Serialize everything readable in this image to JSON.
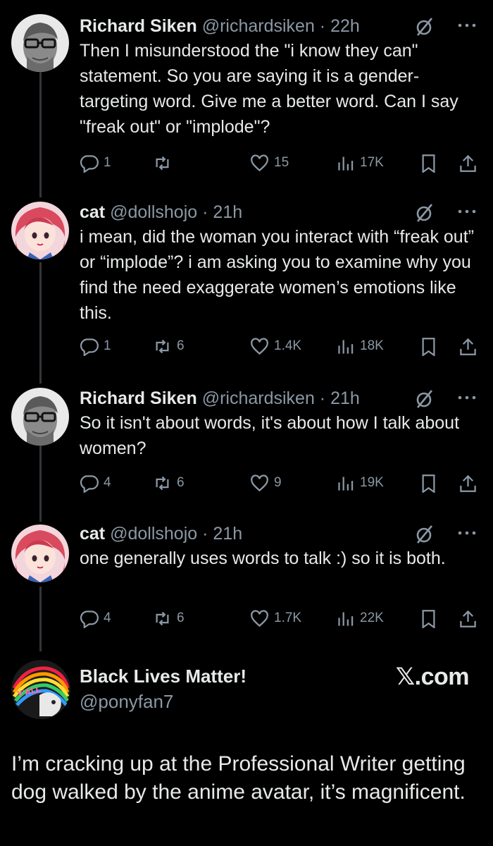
{
  "tweets": [
    {
      "name": "Richard Siken",
      "handle": "@richardsiken",
      "time": "22h",
      "text": "Then I misunderstood the \"i know they can\" statement. So you are saying it is a gender-targeting word. Give me a better word. Can I say \"freak out\" or \"implode\"?",
      "replies": "1",
      "reposts": "",
      "likes": "15",
      "views": "17K"
    },
    {
      "name": "cat",
      "handle": "@dollshojo",
      "time": "21h",
      "text": "i mean, did the woman you interact with “freak out” or “implode”? i am asking you to examine why you find the need exaggerate women’s emotions like this.",
      "replies": "1",
      "reposts": "6",
      "likes": "1.4K",
      "views": "18K"
    },
    {
      "name": "Richard Siken",
      "handle": "@richardsiken",
      "time": "21h",
      "text": "So it isn't about words, it's about how I talk about women?",
      "replies": "4",
      "reposts": "6",
      "likes": "9",
      "views": "19K"
    },
    {
      "name": "cat",
      "handle": "@dollshojo",
      "time": "21h",
      "text": "one generally uses words to talk :) so it is both.",
      "replies": "4",
      "reposts": "6",
      "likes": "1.7K",
      "views": "22K"
    }
  ],
  "separator": "·",
  "quote": {
    "name": "Black Lives Matter!",
    "handle": "@ponyfan7",
    "brand": "𝕏.com",
    "text": "I’m cracking up at the Professional Writer getting dog walked by the anime avatar, it’s magnificent.",
    "avatar_text": "Y'ALL"
  },
  "icons": {
    "reply": "speech-bubble-icon",
    "repost": "repost-arrows-icon",
    "like": "heart-icon",
    "views": "bar-chart-icon",
    "bookmark": "bookmark-icon",
    "share": "share-upload-icon",
    "grok": "grok-slash-icon",
    "more": "more-dots-icon"
  },
  "colors": {
    "background": "#000000",
    "text": "#e7e9ea",
    "muted": "#8b98a5",
    "thread_line": "#333639"
  }
}
